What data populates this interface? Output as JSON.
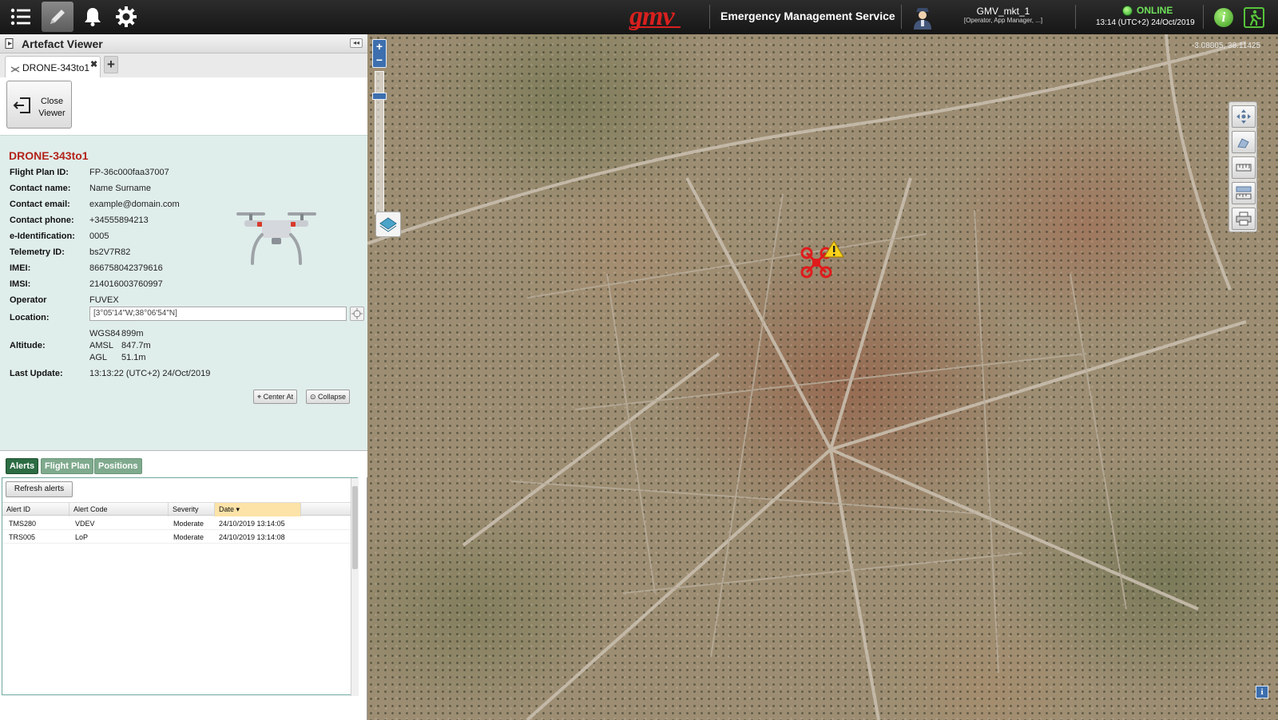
{
  "topbar": {
    "brand": "gmv",
    "app_title": "Emergency Management Service",
    "user_name": "GMV_mkt_1",
    "user_role": "[Operator, App Manager, ...]",
    "status": "ONLINE",
    "status_time": "13:14 (UTC+2) 24/Oct/2019",
    "info_label": "i",
    "icons": [
      "list-menu-icon",
      "pencil-icon",
      "bell-icon",
      "gear-icon",
      "user-avatar-icon",
      "info-icon",
      "exit-icon"
    ]
  },
  "panel": {
    "title": "Artefact Viewer",
    "collapse_label": "◂◂",
    "tab_label": "DRONE-343to1",
    "tab_close": "✖",
    "add_tab": "+",
    "close_viewer_label": "Close Viewer"
  },
  "drone": {
    "title": "DRONE-343to1",
    "fields": [
      {
        "label": "Flight Plan ID:",
        "value": "FP-36c000faa37007"
      },
      {
        "label": "Contact name:",
        "value": "Name Surname"
      },
      {
        "label": "Contact email:",
        "value": "example@domain.com"
      },
      {
        "label": "Contact phone:",
        "value": "+34555894213"
      },
      {
        "label": "e-Identification:",
        "value": "0005"
      },
      {
        "label": "Telemetry ID:",
        "value": "bs2V7R82"
      },
      {
        "label": "IMEI:",
        "value": "866758042379616"
      },
      {
        "label": "IMSI:",
        "value": "214016003760997"
      },
      {
        "label": "Operator",
        "value": "FUVEX"
      }
    ],
    "location_label": "Location:",
    "location_value": "[3°05'14\"W;38°06'54\"N]",
    "altitude_label": "Altitude:",
    "altitude": [
      {
        "ref": "WGS84",
        "value": "899m"
      },
      {
        "ref": "AMSL",
        "value": "847.7m"
      },
      {
        "ref": "AGL",
        "value": "51.1m"
      }
    ],
    "last_update_label": "Last Update:",
    "last_update_value": "13:13:22 (UTC+2) 24/Oct/2019",
    "center_at_label": "Center At",
    "collapse_label": "Collapse"
  },
  "subtabs": [
    "Alerts",
    "Flight Plan",
    "Positions"
  ],
  "alerts": {
    "refresh_label": "Refresh alerts",
    "columns": [
      "Alert ID",
      "Alert Code",
      "Severity",
      "Date ▾"
    ],
    "rows": [
      [
        "TMS280",
        "VDEV",
        "Moderate",
        "24/10/2019 13:14:05"
      ],
      [
        "TRS005",
        "LoP",
        "Moderate",
        "24/10/2019 13:14:08"
      ]
    ]
  },
  "map": {
    "coordinates": "-3.08805, 38.11425",
    "zoom_in": "+",
    "zoom_out": "−",
    "info_label": "i",
    "tools": [
      "pan-icon",
      "measure-area-icon",
      "ruler-icon",
      "ruler-area-icon",
      "printer-icon"
    ]
  }
}
